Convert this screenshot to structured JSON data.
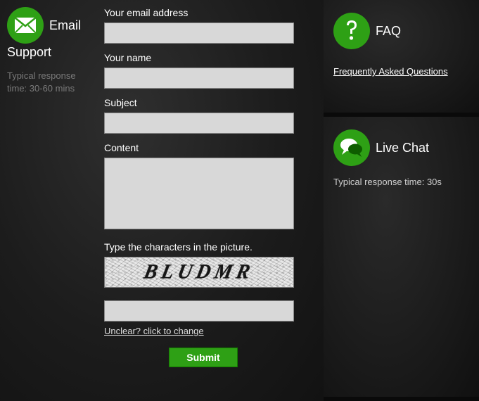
{
  "email": {
    "title_line1": "Email",
    "title_line2": "Support",
    "note": "Typical response time: 30-60 mins"
  },
  "form": {
    "email_label": "Your email address",
    "name_label": "Your name",
    "subject_label": "Subject",
    "content_label": "Content",
    "captcha_label": "Type the characters in the picture.",
    "captcha_text": "BLUDMR",
    "change_link": "Unclear? click to change",
    "submit": "Submit"
  },
  "faq": {
    "title": "FAQ",
    "link": "Frequently Asked Questions"
  },
  "chat": {
    "title": "Live Chat",
    "note": "Typical response time: 30s"
  }
}
